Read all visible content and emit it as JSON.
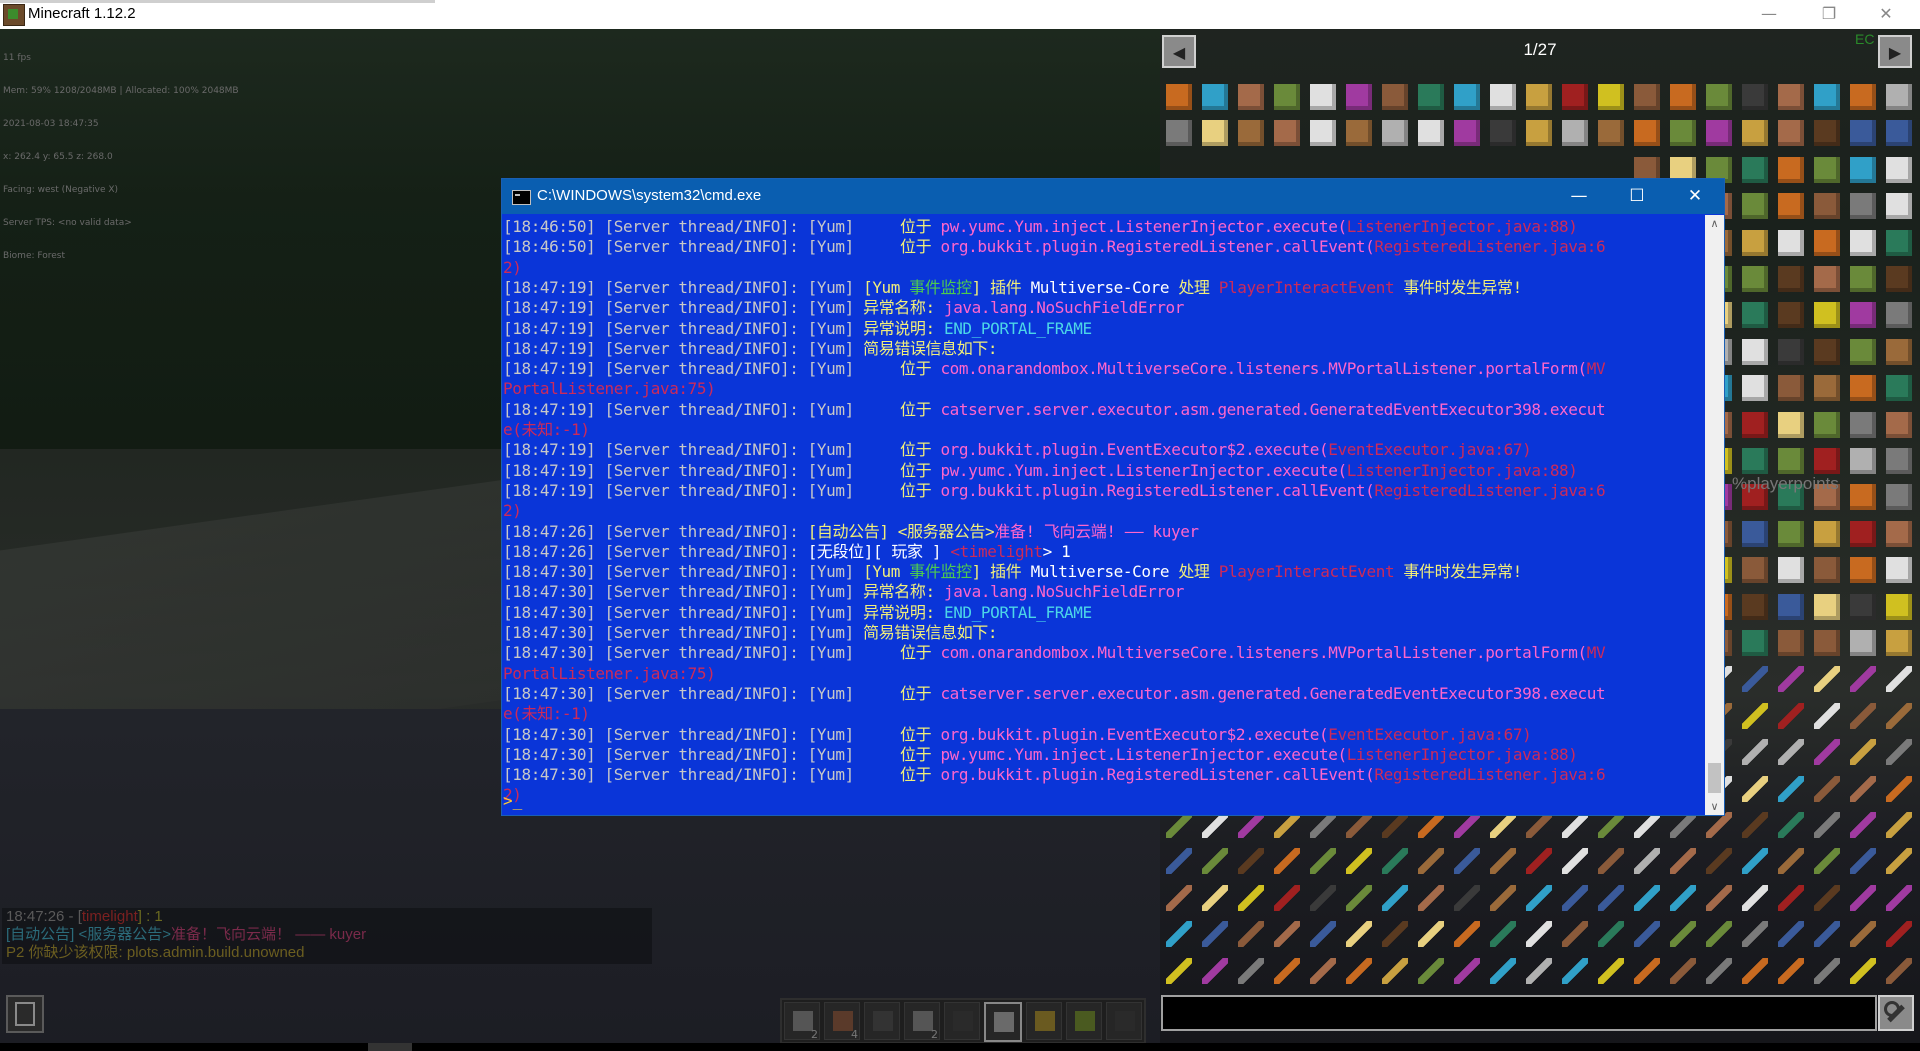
{
  "window": {
    "title": "Minecraft 1.12.2",
    "minimize": "—",
    "restore": "❐",
    "close": "✕"
  },
  "debug": {
    "lines": [
      "11 fps",
      "Mem: 59% 1208/2048MB | Allocated: 100% 2048MB",
      "2021-08-03 18:47:35",
      "x: 262.4 y: 65.5 z: 268.0",
      "Facing: west (Negative X)",
      "Server TPS: <no valid data>",
      "Biome: Forest"
    ]
  },
  "chat": {
    "line1": {
      "time": "18:47:26",
      "prefix": " - [",
      "user": "timelight",
      "suffix": "] : 1"
    },
    "line2": {
      "tag": "[自动公告]",
      "tag2": " <服务器公告>",
      "msg": "准备！飞向云端！ —— kuyer"
    },
    "line3": {
      "p": "P2",
      "msg": " 你缺少该权限: ",
      "perm": "plots.admin.build.unowned"
    }
  },
  "hotbar": {
    "slots": [
      {
        "count": "2",
        "color": "#555"
      },
      {
        "count": "4",
        "color": "#5a3a2a"
      },
      {
        "count": "",
        "color": "#333"
      },
      {
        "count": "2",
        "color": "#555"
      },
      {
        "count": "",
        "color": "#2a2a2a"
      },
      {
        "count": "",
        "color": "#6a6a6a"
      },
      {
        "count": "",
        "color": "#6a5a20"
      },
      {
        "count": "",
        "color": "#4a5a20"
      },
      {
        "count": "",
        "color": "#2a2a2a"
      }
    ]
  },
  "jei": {
    "prev": "◀",
    "next": "▶",
    "page": "1/27",
    "mod_label": "EC",
    "overlay_text": "%playerpoints",
    "search_value": ""
  },
  "cmd": {
    "title": "C:\\WINDOWS\\system32\\cmd.exe",
    "minimize": "—",
    "maximize": "☐",
    "close": "✕",
    "scroll_up": "∧",
    "scroll_down": "∨",
    "cursor": ">_",
    "lines": [
      [
        {
          "t": "[18:46:50] [Server thread/INFO]: [Yum]     ",
          "c": "t-gray"
        },
        {
          "t": "位于 ",
          "c": "t-yellow"
        },
        {
          "t": "pw.yumc.Yum.inject.ListenerInjector.execute(",
          "c": "t-pink"
        },
        {
          "t": "ListenerInjector.java:88)",
          "c": "t-darkred"
        }
      ],
      [
        {
          "t": "[18:46:50] [Server thread/INFO]: [Yum]     ",
          "c": "t-gray"
        },
        {
          "t": "位于 ",
          "c": "t-yellow"
        },
        {
          "t": "org.bukkit.plugin.RegisteredListener.callEvent(",
          "c": "t-pink"
        },
        {
          "t": "RegisteredListener.java:6",
          "c": "t-darkred"
        }
      ],
      [
        {
          "t": "2)",
          "c": "t-darkred"
        }
      ],
      [
        {
          "t": "[18:47:19] [Server thread/INFO]: [Yum] ",
          "c": "t-gray"
        },
        {
          "t": "[Yum ",
          "c": "t-yellow"
        },
        {
          "t": "事件监控",
          "c": "t-green"
        },
        {
          "t": "] 插件 ",
          "c": "t-yellow"
        },
        {
          "t": "Multiverse-Core ",
          "c": "t-white"
        },
        {
          "t": "处理 ",
          "c": "t-yellow"
        },
        {
          "t": "PlayerInteractEvent ",
          "c": "t-darkred"
        },
        {
          "t": "事件时发生异常!",
          "c": "t-yellow"
        }
      ],
      [
        {
          "t": "[18:47:19] [Server thread/INFO]: [Yum] ",
          "c": "t-gray"
        },
        {
          "t": "异常名称: ",
          "c": "t-yellow"
        },
        {
          "t": "java.lang.NoSuchFieldError",
          "c": "t-pink"
        }
      ],
      [
        {
          "t": "[18:47:19] [Server thread/INFO]: [Yum] ",
          "c": "t-gray"
        },
        {
          "t": "异常说明: ",
          "c": "t-yellow"
        },
        {
          "t": "END_PORTAL_FRAME",
          "c": "t-aqua"
        }
      ],
      [
        {
          "t": "[18:47:19] [Server thread/INFO]: [Yum] ",
          "c": "t-gray"
        },
        {
          "t": "简易错误信息如下:",
          "c": "t-yellow"
        }
      ],
      [
        {
          "t": "[18:47:19] [Server thread/INFO]: [Yum]     ",
          "c": "t-gray"
        },
        {
          "t": "位于 ",
          "c": "t-yellow"
        },
        {
          "t": "com.onarandombox.MultiverseCore.listeners.MVPortalListener.portalForm(",
          "c": "t-pink"
        },
        {
          "t": "MV",
          "c": "t-darkred"
        }
      ],
      [
        {
          "t": "PortalListener.java:75)",
          "c": "t-darkred"
        }
      ],
      [
        {
          "t": "[18:47:19] [Server thread/INFO]: [Yum]     ",
          "c": "t-gray"
        },
        {
          "t": "位于 ",
          "c": "t-yellow"
        },
        {
          "t": "catserver.server.executor.asm.generated.GeneratedEventExecutor398.execut",
          "c": "t-pink"
        }
      ],
      [
        {
          "t": "e(未知:-1)",
          "c": "t-darkred"
        }
      ],
      [
        {
          "t": "[18:47:19] [Server thread/INFO]: [Yum]     ",
          "c": "t-gray"
        },
        {
          "t": "位于 ",
          "c": "t-yellow"
        },
        {
          "t": "org.bukkit.plugin.EventExecutor$2.execute(",
          "c": "t-pink"
        },
        {
          "t": "EventExecutor.java:67)",
          "c": "t-darkred"
        }
      ],
      [
        {
          "t": "[18:47:19] [Server thread/INFO]: [Yum]     ",
          "c": "t-gray"
        },
        {
          "t": "位于 ",
          "c": "t-yellow"
        },
        {
          "t": "pw.yumc.Yum.inject.ListenerInjector.execute(",
          "c": "t-pink"
        },
        {
          "t": "ListenerInjector.java:88)",
          "c": "t-darkred"
        }
      ],
      [
        {
          "t": "[18:47:19] [Server thread/INFO]: [Yum]     ",
          "c": "t-gray"
        },
        {
          "t": "位于 ",
          "c": "t-yellow"
        },
        {
          "t": "org.bukkit.plugin.RegisteredListener.callEvent(",
          "c": "t-pink"
        },
        {
          "t": "RegisteredListener.java:6",
          "c": "t-darkred"
        }
      ],
      [
        {
          "t": "2)",
          "c": "t-darkred"
        }
      ],
      [
        {
          "t": "[18:47:26] [Server thread/INFO]: ",
          "c": "t-gray"
        },
        {
          "t": "[自动公告] <服务器公告>",
          "c": "t-yellow"
        },
        {
          "t": "准备! 飞向云端! —— kuyer",
          "c": "t-pink"
        }
      ],
      [
        {
          "t": "[18:47:26] [Server thread/INFO]: ",
          "c": "t-gray"
        },
        {
          "t": "[无段位][ 玩家 ] ",
          "c": "t-white"
        },
        {
          "t": "<timelight",
          "c": "t-darkred"
        },
        {
          "t": "> 1",
          "c": "t-white"
        }
      ],
      [
        {
          "t": "[18:47:30] [Server thread/INFO]: [Yum] ",
          "c": "t-gray"
        },
        {
          "t": "[Yum ",
          "c": "t-yellow"
        },
        {
          "t": "事件监控",
          "c": "t-green"
        },
        {
          "t": "] 插件 ",
          "c": "t-yellow"
        },
        {
          "t": "Multiverse-Core ",
          "c": "t-white"
        },
        {
          "t": "处理 ",
          "c": "t-yellow"
        },
        {
          "t": "PlayerInteractEvent ",
          "c": "t-darkred"
        },
        {
          "t": "事件时发生异常!",
          "c": "t-yellow"
        }
      ],
      [
        {
          "t": "[18:47:30] [Server thread/INFO]: [Yum] ",
          "c": "t-gray"
        },
        {
          "t": "异常名称: ",
          "c": "t-yellow"
        },
        {
          "t": "java.lang.NoSuchFieldError",
          "c": "t-pink"
        }
      ],
      [
        {
          "t": "[18:47:30] [Server thread/INFO]: [Yum] ",
          "c": "t-gray"
        },
        {
          "t": "异常说明: ",
          "c": "t-yellow"
        },
        {
          "t": "END_PORTAL_FRAME",
          "c": "t-aqua"
        }
      ],
      [
        {
          "t": "[18:47:30] [Server thread/INFO]: [Yum] ",
          "c": "t-gray"
        },
        {
          "t": "简易错误信息如下:",
          "c": "t-yellow"
        }
      ],
      [
        {
          "t": "[18:47:30] [Server thread/INFO]: [Yum]     ",
          "c": "t-gray"
        },
        {
          "t": "位于 ",
          "c": "t-yellow"
        },
        {
          "t": "com.onarandombox.MultiverseCore.listeners.MVPortalListener.portalForm(",
          "c": "t-pink"
        },
        {
          "t": "MV",
          "c": "t-darkred"
        }
      ],
      [
        {
          "t": "PortalListener.java:75)",
          "c": "t-darkred"
        }
      ],
      [
        {
          "t": "[18:47:30] [Server thread/INFO]: [Yum]     ",
          "c": "t-gray"
        },
        {
          "t": "位于 ",
          "c": "t-yellow"
        },
        {
          "t": "catserver.server.executor.asm.generated.GeneratedEventExecutor398.execut",
          "c": "t-pink"
        }
      ],
      [
        {
          "t": "e(未知:-1)",
          "c": "t-darkred"
        }
      ],
      [
        {
          "t": "[18:47:30] [Server thread/INFO]: [Yum]     ",
          "c": "t-gray"
        },
        {
          "t": "位于 ",
          "c": "t-yellow"
        },
        {
          "t": "org.bukkit.plugin.EventExecutor$2.execute(",
          "c": "t-pink"
        },
        {
          "t": "EventExecutor.java:67)",
          "c": "t-darkred"
        }
      ],
      [
        {
          "t": "[18:47:30] [Server thread/INFO]: [Yum]     ",
          "c": "t-gray"
        },
        {
          "t": "位于 ",
          "c": "t-yellow"
        },
        {
          "t": "pw.yumc.Yum.inject.ListenerInjector.execute(",
          "c": "t-pink"
        },
        {
          "t": "ListenerInjector.java:88)",
          "c": "t-darkred"
        }
      ],
      [
        {
          "t": "[18:47:30] [Server thread/INFO]: [Yum]     ",
          "c": "t-gray"
        },
        {
          "t": "位于 ",
          "c": "t-yellow"
        },
        {
          "t": "org.bukkit.plugin.RegisteredListener.callEvent(",
          "c": "t-pink"
        },
        {
          "t": "RegisteredListener.java:6",
          "c": "t-darkred"
        }
      ],
      [
        {
          "t": "2)",
          "c": "t-darkred"
        }
      ]
    ]
  },
  "colors": {
    "cmd_background": "#0a35d8",
    "cmd_titlebar": "#0a5eb0",
    "jei_button": "#8a8a8a"
  }
}
